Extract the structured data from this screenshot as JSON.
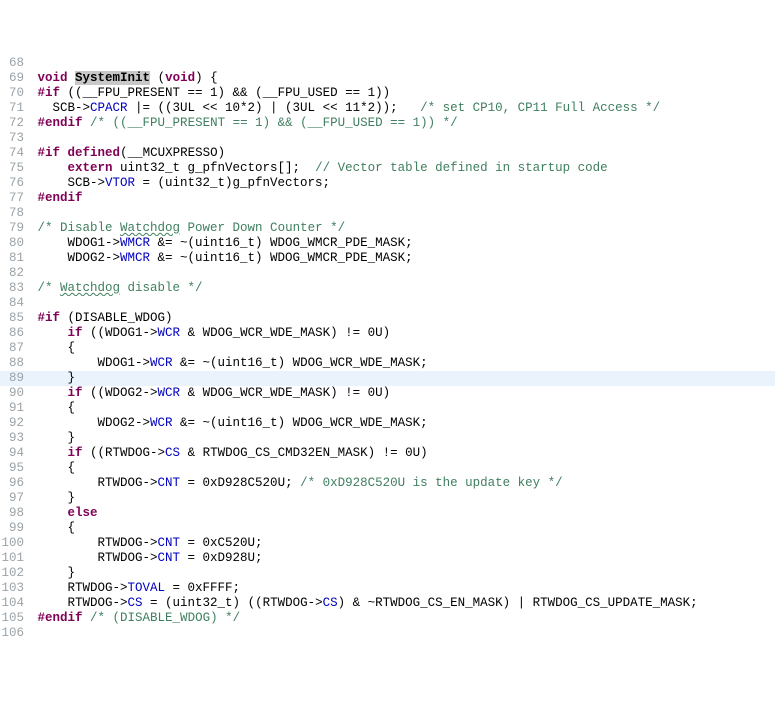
{
  "lines": [
    {
      "num": "68",
      "hl": false,
      "tokens": []
    },
    {
      "num": "69",
      "hl": false,
      "tokens": [
        {
          "t": " ",
          "c": "txt"
        },
        {
          "t": "void",
          "c": "kw"
        },
        {
          "t": " ",
          "c": "txt"
        },
        {
          "t": "SystemInit",
          "c": "fn fn-hl"
        },
        {
          "t": " (",
          "c": "txt"
        },
        {
          "t": "void",
          "c": "kw"
        },
        {
          "t": ") {",
          "c": "txt"
        }
      ]
    },
    {
      "num": "70",
      "hl": false,
      "tokens": [
        {
          "t": " ",
          "c": "txt"
        },
        {
          "t": "#if",
          "c": "pp"
        },
        {
          "t": " ((__FPU_PRESENT == 1) && (__FPU_USED == 1))",
          "c": "txt"
        }
      ]
    },
    {
      "num": "71",
      "hl": false,
      "tokens": [
        {
          "t": "   SCB->",
          "c": "txt"
        },
        {
          "t": "CPACR",
          "c": "mem"
        },
        {
          "t": " |= ((3UL << 10*2) | (3UL << 11*2));   ",
          "c": "txt"
        },
        {
          "t": "/* set CP10, CP11 Full Access */",
          "c": "cm"
        }
      ]
    },
    {
      "num": "72",
      "hl": false,
      "tokens": [
        {
          "t": " ",
          "c": "txt"
        },
        {
          "t": "#endif",
          "c": "pp"
        },
        {
          "t": " ",
          "c": "txt"
        },
        {
          "t": "/* ((__FPU_PRESENT == 1) && (__FPU_USED == 1)) */",
          "c": "cm"
        }
      ]
    },
    {
      "num": "73",
      "hl": false,
      "tokens": []
    },
    {
      "num": "74",
      "hl": false,
      "tokens": [
        {
          "t": " ",
          "c": "txt"
        },
        {
          "t": "#if",
          "c": "pp"
        },
        {
          "t": " ",
          "c": "txt"
        },
        {
          "t": "defined",
          "c": "kw"
        },
        {
          "t": "(__MCUXPRESSO)",
          "c": "txt"
        }
      ]
    },
    {
      "num": "75",
      "hl": false,
      "tokens": [
        {
          "t": "     ",
          "c": "txt"
        },
        {
          "t": "extern",
          "c": "kw"
        },
        {
          "t": " uint32_t g_pfnVectors[];  ",
          "c": "txt"
        },
        {
          "t": "// Vector table defined in startup code",
          "c": "cm"
        }
      ]
    },
    {
      "num": "76",
      "hl": false,
      "tokens": [
        {
          "t": "     SCB->",
          "c": "txt"
        },
        {
          "t": "VTOR",
          "c": "mem"
        },
        {
          "t": " = (uint32_t)g_pfnVectors;",
          "c": "txt"
        }
      ]
    },
    {
      "num": "77",
      "hl": false,
      "tokens": [
        {
          "t": " ",
          "c": "txt"
        },
        {
          "t": "#endif",
          "c": "pp"
        }
      ]
    },
    {
      "num": "78",
      "hl": false,
      "tokens": []
    },
    {
      "num": "79",
      "hl": false,
      "tokens": [
        {
          "t": " ",
          "c": "txt"
        },
        {
          "t": "/* Disable ",
          "c": "cm"
        },
        {
          "t": "Watchdog",
          "c": "cm wavy"
        },
        {
          "t": " Power Down Counter */",
          "c": "cm"
        }
      ]
    },
    {
      "num": "80",
      "hl": false,
      "tokens": [
        {
          "t": "     WDOG1->",
          "c": "txt"
        },
        {
          "t": "WMCR",
          "c": "mem"
        },
        {
          "t": " &= ~(uint16_t) WDOG_WMCR_PDE_MASK;",
          "c": "txt"
        }
      ]
    },
    {
      "num": "81",
      "hl": false,
      "tokens": [
        {
          "t": "     WDOG2->",
          "c": "txt"
        },
        {
          "t": "WMCR",
          "c": "mem"
        },
        {
          "t": " &= ~(uint16_t) WDOG_WMCR_PDE_MASK;",
          "c": "txt"
        }
      ]
    },
    {
      "num": "82",
      "hl": false,
      "tokens": []
    },
    {
      "num": "83",
      "hl": false,
      "tokens": [
        {
          "t": " ",
          "c": "txt"
        },
        {
          "t": "/* ",
          "c": "cm"
        },
        {
          "t": "Watchdog",
          "c": "cm wavy"
        },
        {
          "t": " disable */",
          "c": "cm"
        }
      ]
    },
    {
      "num": "84",
      "hl": false,
      "tokens": []
    },
    {
      "num": "85",
      "hl": false,
      "tokens": [
        {
          "t": " ",
          "c": "txt"
        },
        {
          "t": "#if",
          "c": "pp"
        },
        {
          "t": " (DISABLE_WDOG)",
          "c": "txt"
        }
      ]
    },
    {
      "num": "86",
      "hl": false,
      "tokens": [
        {
          "t": "     ",
          "c": "txt"
        },
        {
          "t": "if",
          "c": "kw"
        },
        {
          "t": " ((WDOG1->",
          "c": "txt"
        },
        {
          "t": "WCR",
          "c": "mem"
        },
        {
          "t": " & WDOG_WCR_WDE_MASK) != 0U)",
          "c": "txt"
        }
      ]
    },
    {
      "num": "87",
      "hl": false,
      "tokens": [
        {
          "t": "     {",
          "c": "txt"
        }
      ]
    },
    {
      "num": "88",
      "hl": false,
      "tokens": [
        {
          "t": "         WDOG1->",
          "c": "txt"
        },
        {
          "t": "WCR",
          "c": "mem"
        },
        {
          "t": " &= ~(uint16_t) WDOG_WCR_WDE_MASK;",
          "c": "txt"
        }
      ]
    },
    {
      "num": "89",
      "hl": true,
      "tokens": [
        {
          "t": "     }",
          "c": "txt"
        }
      ]
    },
    {
      "num": "90",
      "hl": false,
      "tokens": [
        {
          "t": "     ",
          "c": "txt"
        },
        {
          "t": "if",
          "c": "kw"
        },
        {
          "t": " ((WDOG2->",
          "c": "txt"
        },
        {
          "t": "WCR",
          "c": "mem"
        },
        {
          "t": " & WDOG_WCR_WDE_MASK) != 0U)",
          "c": "txt"
        }
      ]
    },
    {
      "num": "91",
      "hl": false,
      "tokens": [
        {
          "t": "     {",
          "c": "txt"
        }
      ]
    },
    {
      "num": "92",
      "hl": false,
      "tokens": [
        {
          "t": "         WDOG2->",
          "c": "txt"
        },
        {
          "t": "WCR",
          "c": "mem"
        },
        {
          "t": " &= ~(uint16_t) WDOG_WCR_WDE_MASK;",
          "c": "txt"
        }
      ]
    },
    {
      "num": "93",
      "hl": false,
      "tokens": [
        {
          "t": "     }",
          "c": "txt"
        }
      ]
    },
    {
      "num": "94",
      "hl": false,
      "tokens": [
        {
          "t": "     ",
          "c": "txt"
        },
        {
          "t": "if",
          "c": "kw"
        },
        {
          "t": " ((RTWDOG->",
          "c": "txt"
        },
        {
          "t": "CS",
          "c": "mem"
        },
        {
          "t": " & RTWDOG_CS_CMD32EN_MASK) != 0U)",
          "c": "txt"
        }
      ]
    },
    {
      "num": "95",
      "hl": false,
      "tokens": [
        {
          "t": "     {",
          "c": "txt"
        }
      ]
    },
    {
      "num": "96",
      "hl": false,
      "tokens": [
        {
          "t": "         RTWDOG->",
          "c": "txt"
        },
        {
          "t": "CNT",
          "c": "mem"
        },
        {
          "t": " = 0xD928C520U; ",
          "c": "txt"
        },
        {
          "t": "/* 0xD928C520U is the update key */",
          "c": "cm"
        }
      ]
    },
    {
      "num": "97",
      "hl": false,
      "tokens": [
        {
          "t": "     }",
          "c": "txt"
        }
      ]
    },
    {
      "num": "98",
      "hl": false,
      "tokens": [
        {
          "t": "     ",
          "c": "txt"
        },
        {
          "t": "else",
          "c": "kw"
        }
      ]
    },
    {
      "num": "99",
      "hl": false,
      "tokens": [
        {
          "t": "     {",
          "c": "txt"
        }
      ]
    },
    {
      "num": "100",
      "hl": false,
      "tokens": [
        {
          "t": "         RTWDOG->",
          "c": "txt"
        },
        {
          "t": "CNT",
          "c": "mem"
        },
        {
          "t": " = 0xC520U;",
          "c": "txt"
        }
      ]
    },
    {
      "num": "101",
      "hl": false,
      "tokens": [
        {
          "t": "         RTWDOG->",
          "c": "txt"
        },
        {
          "t": "CNT",
          "c": "mem"
        },
        {
          "t": " = 0xD928U;",
          "c": "txt"
        }
      ]
    },
    {
      "num": "102",
      "hl": false,
      "tokens": [
        {
          "t": "     }",
          "c": "txt"
        }
      ]
    },
    {
      "num": "103",
      "hl": false,
      "tokens": [
        {
          "t": "     RTWDOG->",
          "c": "txt"
        },
        {
          "t": "TOVAL",
          "c": "mem"
        },
        {
          "t": " = 0xFFFF;",
          "c": "txt"
        }
      ]
    },
    {
      "num": "104",
      "hl": false,
      "tokens": [
        {
          "t": "     RTWDOG->",
          "c": "txt"
        },
        {
          "t": "CS",
          "c": "mem"
        },
        {
          "t": " = (uint32_t) ((RTWDOG->",
          "c": "txt"
        },
        {
          "t": "CS",
          "c": "mem"
        },
        {
          "t": ") & ~RTWDOG_CS_EN_MASK) | RTWDOG_CS_UPDATE_MASK;",
          "c": "txt"
        }
      ]
    },
    {
      "num": "105",
      "hl": false,
      "tokens": [
        {
          "t": " ",
          "c": "txt"
        },
        {
          "t": "#endif",
          "c": "pp"
        },
        {
          "t": " ",
          "c": "txt"
        },
        {
          "t": "/* (DISABLE_WDOG) */",
          "c": "cm"
        }
      ]
    },
    {
      "num": "106",
      "hl": false,
      "tokens": []
    }
  ]
}
